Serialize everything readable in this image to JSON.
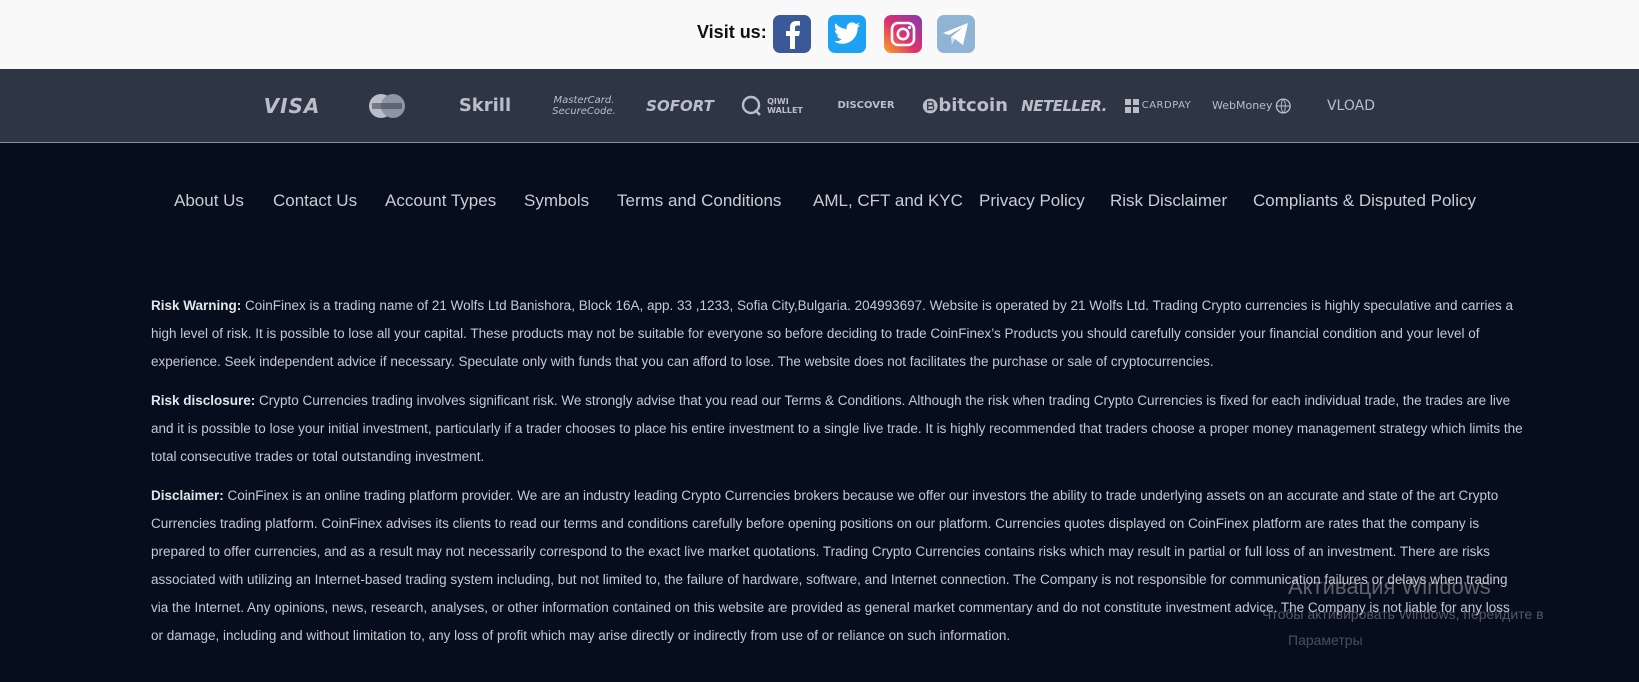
{
  "social": {
    "label": "Visit us:",
    "icons": [
      {
        "name": "facebook-icon",
        "color": "#3b5998"
      },
      {
        "name": "twitter-icon",
        "color": "#1da1f2"
      },
      {
        "name": "instagram-icon",
        "color": "#e1306c"
      },
      {
        "name": "telegram-icon",
        "color": "#8fb4d6"
      }
    ]
  },
  "payments": {
    "visa": "VISA",
    "skrill": "Skrill",
    "mastercard_securecode_line1": "MasterCard.",
    "mastercard_securecode_line2": "SecureCode.",
    "sofort": "SOFORT",
    "qiwi_line1": "QIWI",
    "qiwi_line2": "WALLET",
    "discover": "DISCOVER",
    "bitcoin": "bitcoin",
    "neteller": "NETELLER.",
    "cardpay": "CARDPAY",
    "webmoney": "WebMoney",
    "vload": "VLOAD"
  },
  "nav": {
    "items": [
      "About Us",
      "Contact Us",
      "Account Types",
      "Symbols",
      "Terms and Conditions",
      "AML, CFT and KYC",
      "Privacy Policy",
      "Risk Disclaimer",
      "Compliants & Disputed Policy"
    ]
  },
  "legal": {
    "risk_warning_title": "Risk Warning:",
    "risk_warning_text": " CoinFinex is a trading name of 21 Wolfs Ltd Banishora, Block 16A, app. 33 ,1233, Sofia City,Bulgaria. 204993697. Website is operated by 21 Wolfs Ltd. Trading Crypto currencies is highly speculative and carries a high level of risk. It is possible to lose all your capital. These products may not be suitable for everyone so before deciding to trade CoinFinex’s Products you should carefully consider your financial condition and your level of experience. Seek independent advice if necessary. Speculate only with funds that you can afford to lose. The website does not facilitates the purchase or sale of cryptocurrencies.",
    "risk_disclosure_title": "Risk disclosure:",
    "risk_disclosure_text": " Crypto Currencies trading involves significant risk. We strongly advise that you read our Terms & Conditions. Although the risk when trading Crypto Currencies is fixed for each individual trade, the trades are live and it is possible to lose your initial investment, particularly if a trader chooses to place his entire investment to a single live trade. It is highly recommended that traders choose a proper money management strategy which limits the total consecutive trades or total outstanding investment.",
    "disclaimer_title": "Disclaimer:",
    "disclaimer_text": " CoinFinex is an online trading platform provider. We are an industry leading Crypto Currencies brokers because we offer our investors the ability to trade underlying assets on an accurate and state of the art Crypto Currencies trading platform. CoinFinex advises its clients to read our terms and conditions carefully before opening positions on our platform. Currencies quotes displayed on CoinFinex platform are rates that the company is prepared to offer currencies, and as a result may not necessarily correspond to the exact live market quotations. Trading Crypto Currencies contains risks which may result in partial or full loss of an investment. There are risks associated with utilizing an Internet-based trading system including, but not limited to, the failure of hardware, software, and Internet connection. The Company is not responsible for communication failures or delays when trading via the Internet. Any opinions, news, research, analyses, or other information contained on this website are provided as general market commentary and do not constitute investment advice. The Company is not liable for any loss or damage, including and without limitation to, any loss of profit which may arise directly or indirectly from use of or reliance on such information."
  },
  "watermark": {
    "title": "Активация Windows",
    "line1": "Чтобы активировать Windows, перейдите в",
    "line2": "Параметры"
  }
}
